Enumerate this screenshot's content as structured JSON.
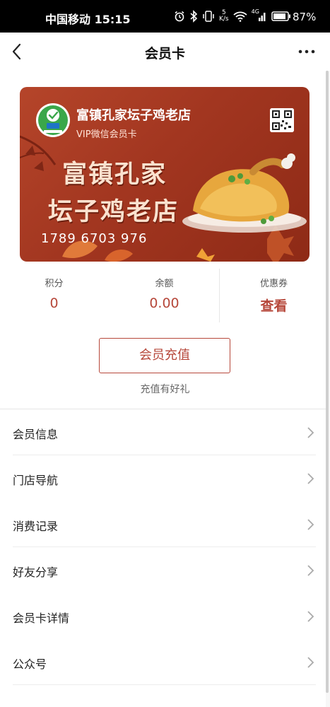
{
  "status_bar": {
    "carrier_time": "中国移动 15:15",
    "net_speed": "5",
    "net_speed_unit": "K/s",
    "signal_tag": "4G",
    "battery_pct": "87%"
  },
  "nav": {
    "title": "会员卡"
  },
  "card": {
    "shop_name": "富镇孔家坛子鸡老店",
    "subtitle": "VIP微信会员卡",
    "headline_line1": "富镇孔家",
    "headline_line2": "坛子鸡老店",
    "card_number": "1789 6703 976",
    "colors": {
      "primary": "#a23620",
      "accent": "#b6473a"
    }
  },
  "stats": [
    {
      "label": "积分",
      "value": "0"
    },
    {
      "label": "余额",
      "value": "0.00"
    },
    {
      "label": "优惠券",
      "value": "查看"
    }
  ],
  "recharge": {
    "button_label": "会员充值",
    "note": "充值有好礼"
  },
  "menu": [
    {
      "label": "会员信息"
    },
    {
      "label": "门店导航"
    },
    {
      "label": "消费记录"
    },
    {
      "label": "好友分享"
    },
    {
      "label": "会员卡详情"
    },
    {
      "label": "公众号"
    }
  ]
}
